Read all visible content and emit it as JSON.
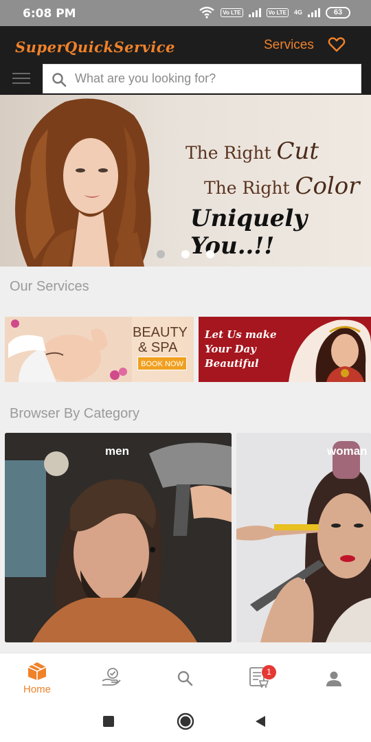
{
  "status_bar": {
    "time": "6:08 PM",
    "volte_1": "Vo LTE",
    "volte_2": "Vo LTE",
    "network": "4G",
    "battery": "63"
  },
  "header": {
    "brand": "SuperQuickService",
    "services_label": "Services",
    "search_placeholder": "What are you looking for?"
  },
  "hero": {
    "line1_prefix": "The Right ",
    "line1_accent": "Cut",
    "line2_prefix": "The Right ",
    "line2_accent": "Color",
    "line3": "Uniquely You..!!",
    "dots": 3,
    "active_dot": 0
  },
  "our_services": {
    "title": "Our Services",
    "beauty_line1": "BEAUTY",
    "beauty_line2": "& SPA",
    "book_now": "BOOK NOW",
    "wedding_text": "Let Us make Your Day Beautiful"
  },
  "categories": {
    "title": "Browser By Category",
    "items": [
      {
        "label": "men"
      },
      {
        "label": "woman"
      }
    ]
  },
  "bottom_nav": {
    "items": [
      {
        "label": "Home",
        "icon": "home-box-icon",
        "active": true
      },
      {
        "label": "",
        "icon": "hand-check-icon",
        "active": false
      },
      {
        "label": "",
        "icon": "search-icon",
        "active": false
      },
      {
        "label": "",
        "icon": "cart-icon",
        "active": false
      },
      {
        "label": "",
        "icon": "user-icon",
        "active": false
      }
    ],
    "cart_badge": "1"
  },
  "colors": {
    "accent": "#f0822a",
    "header_bg": "#1d1d1d",
    "badge": "#e53935"
  }
}
